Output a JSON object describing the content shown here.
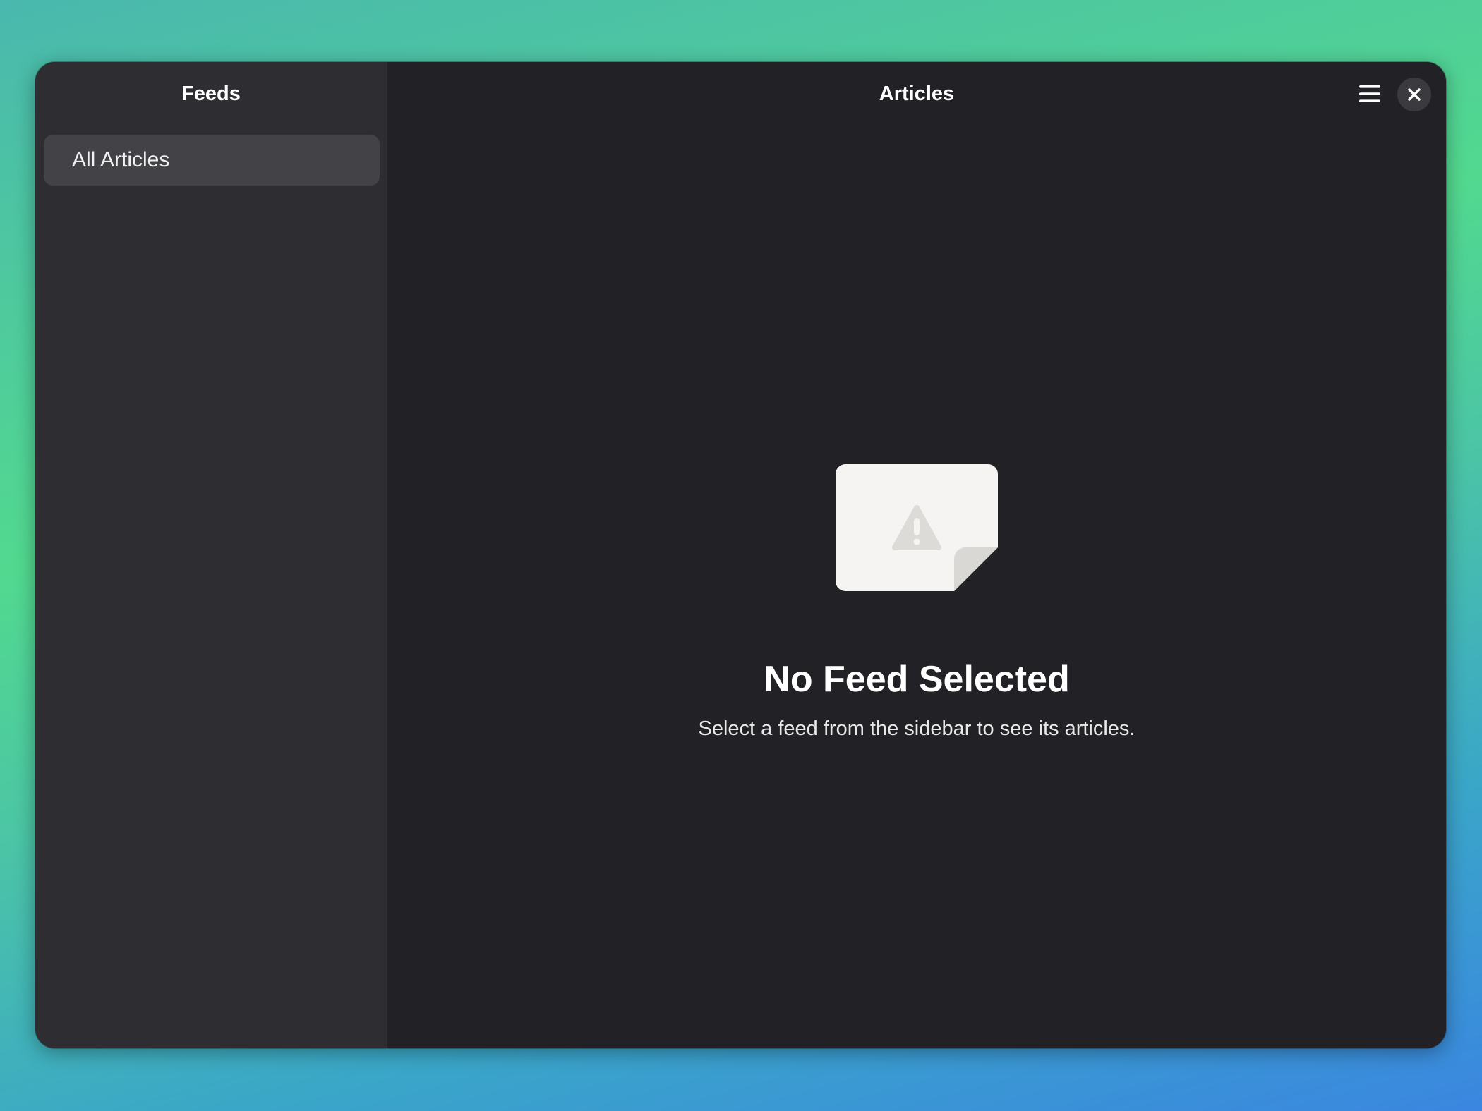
{
  "sidebar": {
    "title": "Feeds",
    "items": [
      {
        "label": "All Articles",
        "selected": true
      }
    ]
  },
  "content": {
    "title": "Articles",
    "menu_icon": "hamburger-menu-icon",
    "close_icon": "close-icon",
    "status": {
      "icon": "document-warning-icon",
      "title": "No Feed Selected",
      "description": "Select a feed from the sidebar to see its articles."
    }
  },
  "colors": {
    "window_bg": "#222226",
    "sidebar_bg": "#2e2e32",
    "selected_item_bg": "#424247",
    "text": "#ffffff",
    "icon_fill": "#f5f4f2"
  }
}
